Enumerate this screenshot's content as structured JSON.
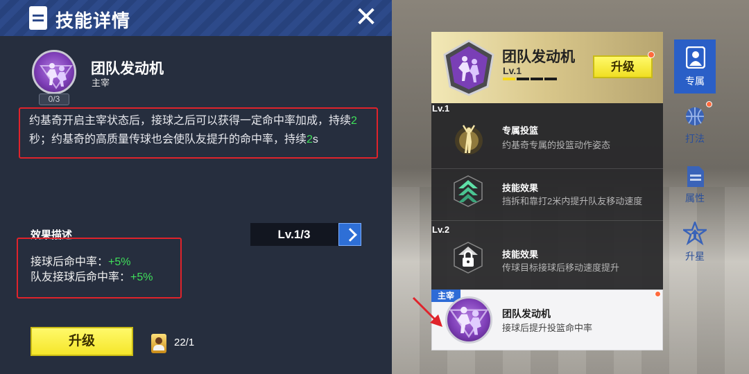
{
  "dialog": {
    "title": "技能详情",
    "skill_name": "团队发动机",
    "skill_role": "主宰",
    "skill_count": "0/3",
    "description_part1": "约基奇开启主宰状态后，接球之后可以获得一定命中率加成，持续",
    "description_num1": "2",
    "description_part2": "秒；约基奇的高质量传球也会使队友提升的命中率，持续",
    "description_num2": "2",
    "description_part3": "s",
    "effect_title": "效果描述",
    "level_selector": "Lv.1/3",
    "effects": [
      {
        "label": "接球后命中率：",
        "value": "+5%"
      },
      {
        "label": "队友接球后命中率：",
        "value": "+5%"
      }
    ],
    "upgrade_label": "升级",
    "card_count": "22/1"
  },
  "skill_panel": {
    "header": {
      "name": "团队发动机",
      "level": "Lv.1",
      "level_progress": 0.25,
      "upgrade_label": "升级"
    },
    "groups": [
      {
        "tag": "Lv.1",
        "rows": [
          {
            "title": "专属投篮",
            "desc": "约基奇专属的投篮动作姿态"
          },
          {
            "title": "技能效果",
            "desc": "挡拆和靠打2米内提升队友移动速度"
          }
        ]
      },
      {
        "tag": "Lv.2",
        "rows": [
          {
            "title": "技能效果",
            "desc": "传球目标接球后移动速度提升"
          }
        ]
      }
    ],
    "active": {
      "tag": "主宰",
      "name": "团队发动机",
      "desc": "接球后提升投篮命中率"
    }
  },
  "side_tabs": [
    {
      "label": "专属",
      "selected": true
    },
    {
      "label": "打法",
      "selected": false
    },
    {
      "label": "属性",
      "selected": false
    },
    {
      "label": "升星",
      "selected": false
    }
  ],
  "colors": {
    "accent_yellow": "#f5e62a",
    "highlight_green": "#3fe05a",
    "annotation_red": "#e0232b",
    "tab_blue": "#2a5fc7"
  }
}
